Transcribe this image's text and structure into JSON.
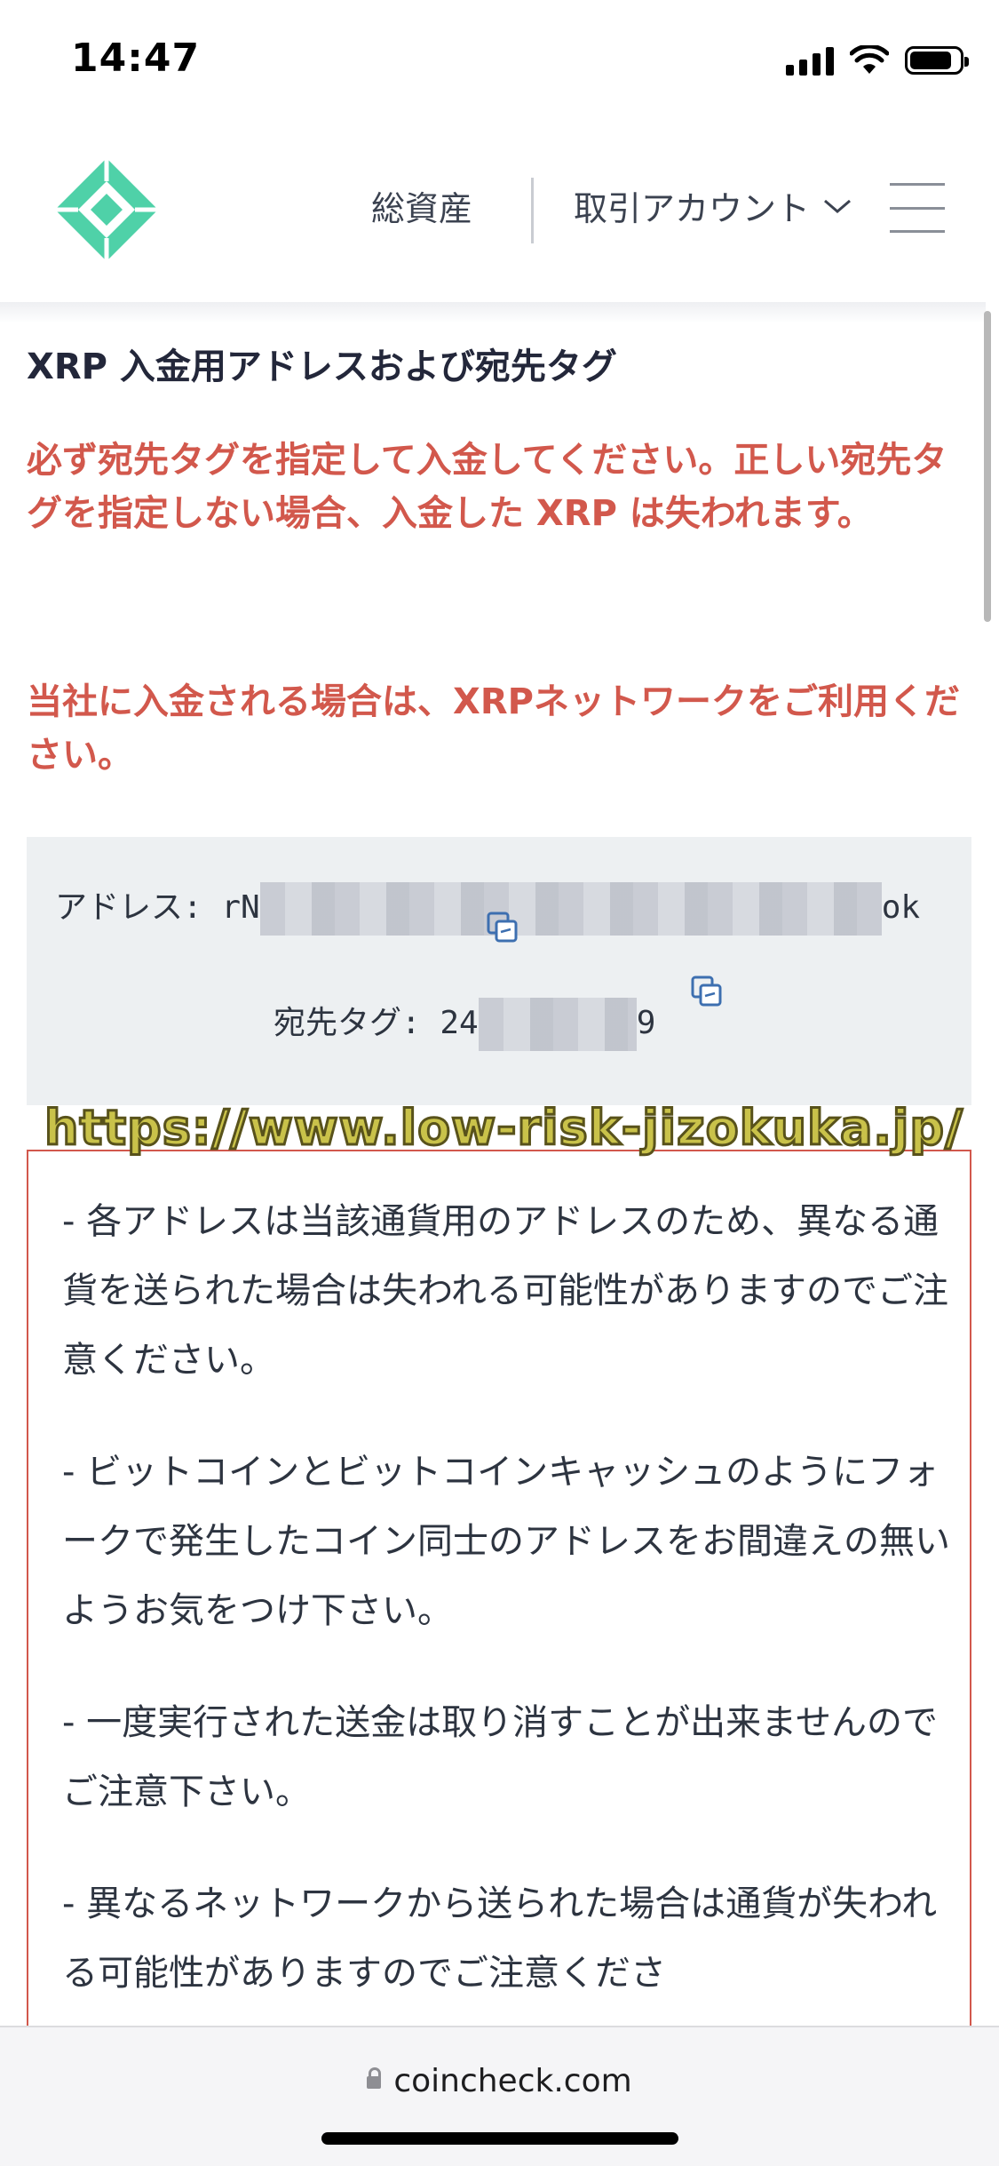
{
  "status_bar": {
    "time": "14:47",
    "battery_level": 0.85
  },
  "header": {
    "nav_assets": "総資産",
    "nav_account": "取引アカウント",
    "brand_color": "#4fd1a8"
  },
  "content": {
    "title": "XRP 入金用アドレスおよび宛先タグ",
    "warning_1": "必ず宛先タグを指定して入金してください。正しい宛先タグを指定しない場合、入金した XRP は失われます。",
    "warning_2": "当社に入金される場合は、XRPネットワークをご利用ください。",
    "address_label": "アドレス:",
    "address_prefix": "rN",
    "address_suffix": "ok",
    "tag_label": "宛先タグ:",
    "tag_prefix": "24",
    "tag_suffix": "9",
    "watermark": "https://www.low-risk-jizokuka.jp/",
    "notes": [
      "- 各アドレスは当該通貨用のアドレスのため、異なる通貨を送られた場合は失われる可能性がありますのでご注意ください。",
      "- ビットコインとビットコインキャッシュのようにフォークで発生したコイン同士のアドレスをお間違えの無いようお気をつけ下さい。",
      "- 一度実行された送金は取り消すことが出来ませんのでご注意下さい。",
      "- 異なるネットワークから送られた場合は通貨が失われる可能性がありますのでご注意くださ"
    ],
    "warning_color": "#d2584c"
  },
  "browser": {
    "url": "coincheck.com"
  }
}
